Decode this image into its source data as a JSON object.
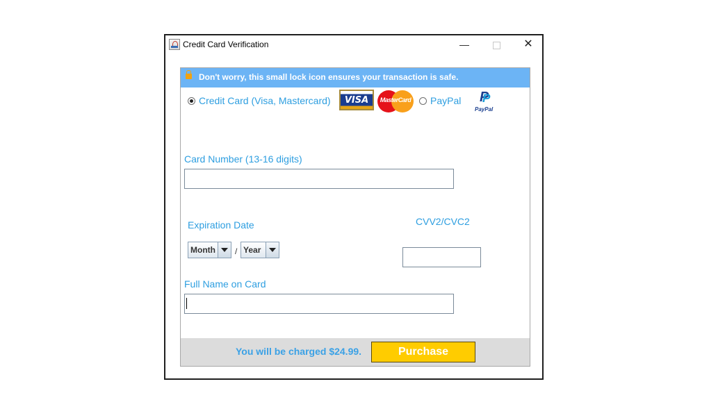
{
  "window": {
    "title": "Credit Card Verification",
    "minimize_glyph": "—",
    "close_glyph": "✕"
  },
  "banner": {
    "text": "Don't worry, this small lock icon ensures your transaction is safe.",
    "icon": "lock-icon",
    "color": "#6cb4f5"
  },
  "payment": {
    "credit_card_label": "Credit Card (Visa, Mastercard)",
    "credit_card_selected": true,
    "paypal_label": "PayPal",
    "paypal_selected": false,
    "visa_logo_text": "VISA",
    "mastercard_logo_text": "MasterCard",
    "paypal_logo_text": "PayPal"
  },
  "form": {
    "card_number_label": "Card Number (13-16 digits)",
    "card_number_value": "",
    "expiration_label": "Expiration Date",
    "month_value": "Month",
    "year_value": "Year",
    "separator": "/",
    "cvv_label": "CVV2/CVC2",
    "cvv_value": "",
    "name_label": "Full Name on Card",
    "name_value": ""
  },
  "footer": {
    "charge_text": "You will be charged $24.99.",
    "purchase_label": "Purchase",
    "purchase_color": "#ffcc00"
  }
}
